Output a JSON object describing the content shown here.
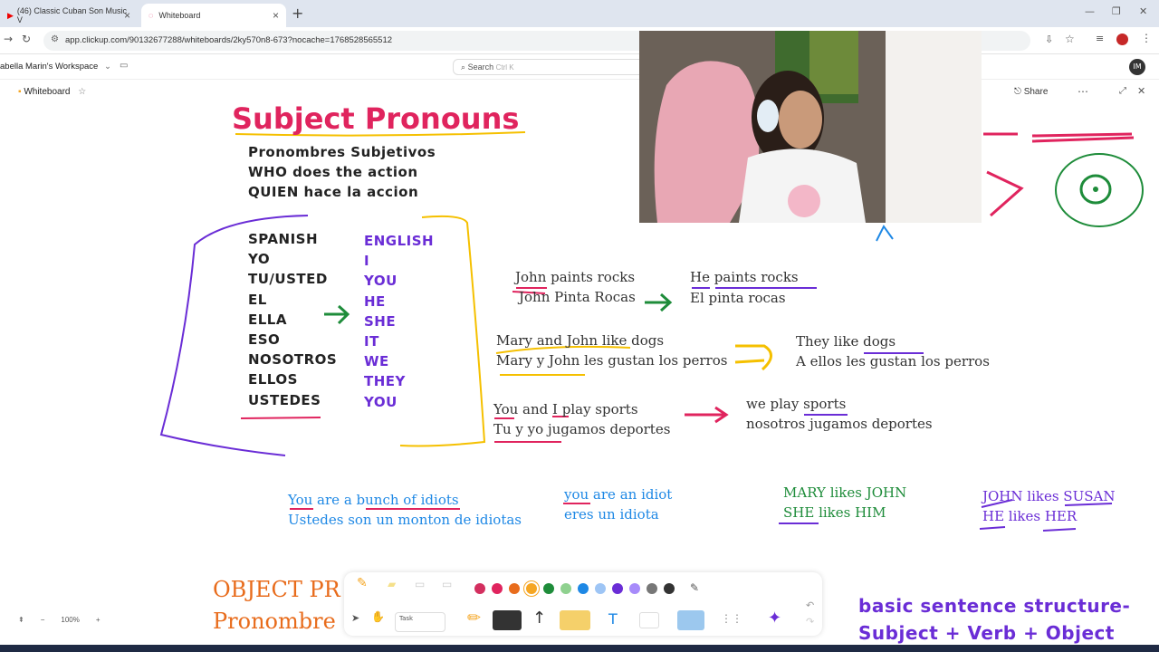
{
  "browser": {
    "tabs": [
      {
        "label": "(46) Classic Cuban Son Music V",
        "active": false
      },
      {
        "label": "Whiteboard",
        "active": true
      }
    ],
    "url": "app.clickup.com/90132677288/whiteboards/2ky570n8-673?nocache=1768528565512"
  },
  "app": {
    "workspace": "abella Marin's Workspace",
    "search_placeholder": "Search",
    "search_shortcut": "Ctrl K",
    "board_title": "Whiteboard",
    "share_label": "Share",
    "avatar": "IM"
  },
  "board": {
    "title": "Subject Pronouns",
    "subtitle_lines": [
      "Pronombres Subjetivos",
      "WHO does the action",
      "QUIEN hace la accion"
    ],
    "spanish_col": [
      "SPANISH",
      "YO",
      "TU/USTED",
      "EL",
      "ELLA",
      "ESO",
      "NOSOTROS",
      "ELLOS",
      "USTEDES"
    ],
    "english_col": [
      "ENGLISH",
      "I",
      "YOU",
      "HE",
      "SHE",
      "IT",
      "WE",
      "THEY",
      "YOU"
    ],
    "examples": [
      {
        "a": "John paints rocks",
        "b": "John Pinta Rocas",
        "c": "He paints rocks",
        "d": "El pinta rocas"
      },
      {
        "a": "Mary and John like dogs",
        "b": "Mary y John les gustan los perros",
        "c": "They like dogs",
        "d": "A ellos les gustan los perros"
      },
      {
        "a": "You and I play sports",
        "b": "Tu y yo jugamos deportes",
        "c": "we play sports",
        "d": "nosotros jugamos deportes"
      }
    ],
    "idiots": {
      "a": "You are a bunch of idiots",
      "b": "Ustedes son un monton de idiotas",
      "c": "you are an idiot",
      "d": "eres un idiota"
    },
    "green_pair": [
      "MARY likes JOHN",
      "SHE likes HIM"
    ],
    "purple_pair": [
      "JOHN likes SUSAN",
      "HE likes HER"
    ],
    "object_title": [
      "OBJECT PR",
      "Pronombre"
    ],
    "sentence_structure": [
      "basic sentence structure-",
      "Subject + Verb + Object"
    ]
  },
  "toolbar": {
    "colors": [
      "#d32f5f",
      "#e0245e",
      "#e86c1c",
      "#f5a623",
      "#1e8c3a",
      "#8fd18f",
      "#1e88e5",
      "#6a2dd6",
      "#a78bfa",
      "#777777",
      "#333333"
    ],
    "tools": [
      "Task",
      "T"
    ]
  },
  "zoom": {
    "value": "100%",
    "minus": "−",
    "plus": "+"
  }
}
